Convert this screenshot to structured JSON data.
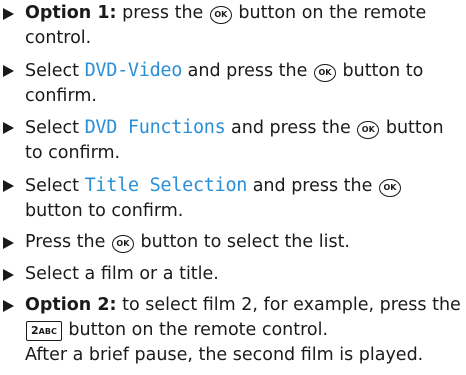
{
  "steps": [
    {
      "bold": "Option 1:",
      "pre": " press the ",
      "ok": "OK",
      "post": " button on the remote control."
    },
    {
      "pre": "Select ",
      "menu": "DVD-Video",
      "mid": " and press the ",
      "ok": "OK",
      "post": " button to confirm."
    },
    {
      "pre": "Select ",
      "menu": "DVD Functions",
      "mid": " and press the ",
      "ok": "OK",
      "post": " but­ton to confirm."
    },
    {
      "pre": "Select ",
      "menu": "Title Selection",
      "mid": " and press the ",
      "ok": "OK",
      "post": " button to confirm."
    },
    {
      "pre": "Press the ",
      "ok": "OK",
      "post": " button to select the list."
    },
    {
      "text": "Select a film or a title."
    },
    {
      "bold": "Option 2:",
      "pre": " to select film 2, for example, press the ",
      "key_num": "2",
      "key_letters": "ABC",
      "post": " button on the remote control.",
      "line2": "After a brief pause, the second film is played."
    }
  ]
}
